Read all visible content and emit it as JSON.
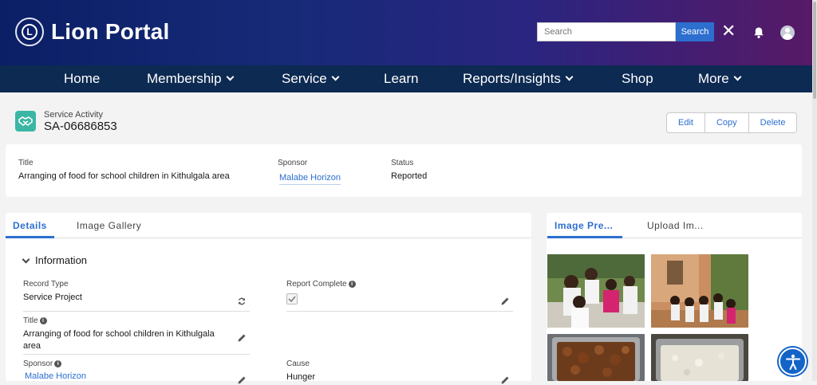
{
  "header": {
    "brand": "Lion Portal",
    "logo_text": "LIONS",
    "search": {
      "placeholder": "Search",
      "button_label": "Search"
    },
    "close_glyph": "✕",
    "colors": {
      "gradient_start": "#0b1f66",
      "gradient_end": "#571a66",
      "search_button": "#2d6fcf"
    }
  },
  "nav": {
    "items": [
      {
        "label": "Home",
        "has_dropdown": false
      },
      {
        "label": "Membership",
        "has_dropdown": true
      },
      {
        "label": "Service",
        "has_dropdown": true
      },
      {
        "label": "Learn",
        "has_dropdown": false
      },
      {
        "label": "Reports/Insights",
        "has_dropdown": true
      },
      {
        "label": "Shop",
        "has_dropdown": false
      },
      {
        "label": "More",
        "has_dropdown": true
      }
    ],
    "background": "#0d2a52"
  },
  "record": {
    "object_type": "Service Activity",
    "record_id": "SA-06686853",
    "icon": "handshake-icon",
    "icon_color": "#3bb6a5",
    "actions": [
      "Edit",
      "Copy",
      "Delete"
    ]
  },
  "highlights": {
    "title_label": "Title",
    "title_value": "Arranging of food for school children in Kithulgala area",
    "sponsor_label": "Sponsor",
    "sponsor_value": "Malabe Horizon",
    "status_label": "Status",
    "status_value": "Reported"
  },
  "left_tabs": [
    {
      "label": "Details",
      "active": true
    },
    {
      "label": "Image Gallery",
      "active": false
    }
  ],
  "section": {
    "title": "Information",
    "expanded": true
  },
  "fields": {
    "record_type_label": "Record Type",
    "record_type_value": "Service Project",
    "report_complete_label": "Report Complete",
    "report_complete_checked": true,
    "title_label": "Title",
    "title_value": "Arranging of food for school children in Kithulgala area",
    "sponsor_label": "Sponsor",
    "sponsor_value": "Malabe Horizon",
    "cause_label": "Cause",
    "cause_value": "Hunger"
  },
  "right_tabs": [
    {
      "label": "Image Pre...",
      "active": true
    },
    {
      "label": "Upload Im...",
      "active": false
    }
  ],
  "photos": [
    {
      "name": "photo-children-food-distribution"
    },
    {
      "name": "photo-children-queue-outside-building"
    },
    {
      "name": "photo-tray-of-fried-food"
    },
    {
      "name": "photo-tray-of-rice"
    }
  ],
  "accent": "#2d6fcf"
}
